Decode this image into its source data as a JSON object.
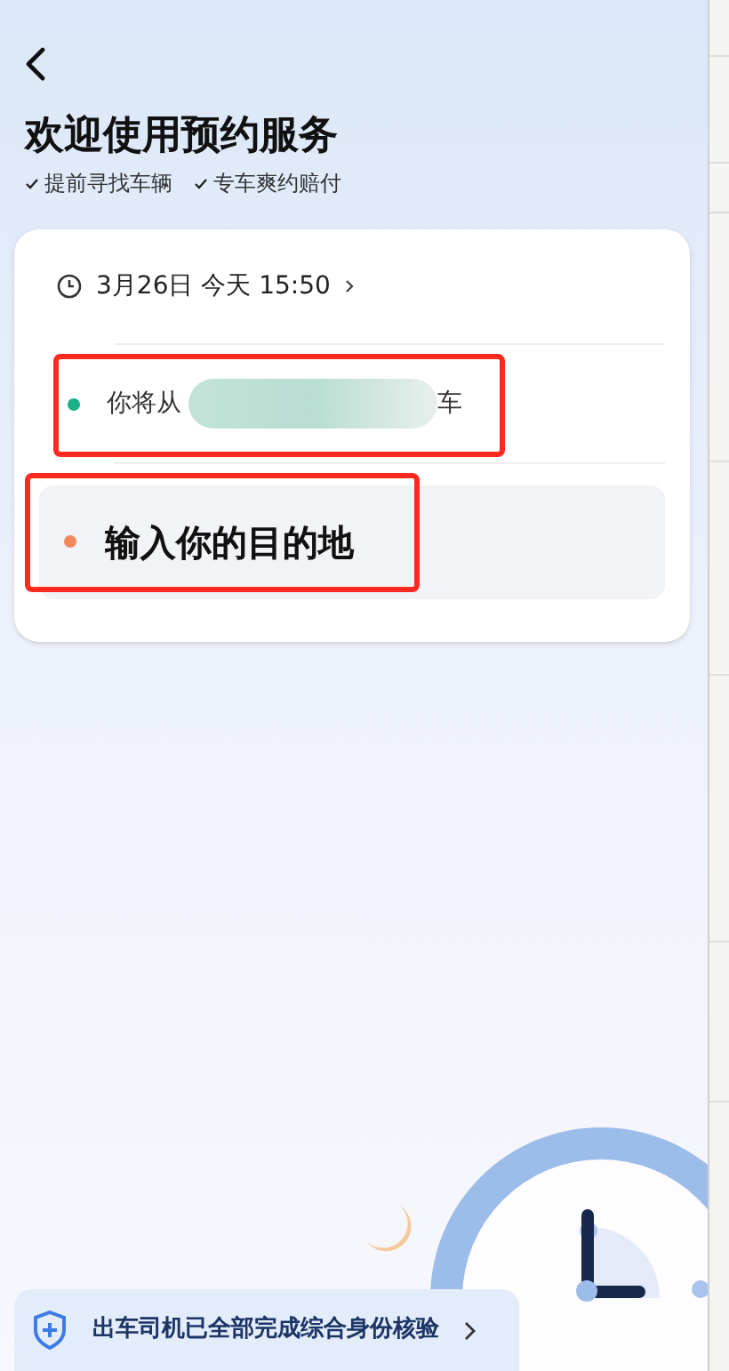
{
  "header": {
    "title": "欢迎使用预约服务",
    "benefits": [
      "提前寻找车辆",
      "专车爽约赔付"
    ]
  },
  "booking": {
    "time": "3月26日 今天 15:50",
    "route": [
      {
        "kind": "pickup",
        "color": "#1bb08c",
        "prefix": "你将从",
        "suffix": "车"
      },
      {
        "kind": "destination",
        "color": "#f3875c",
        "placeholder": "输入你的目的地"
      }
    ]
  },
  "banner": {
    "text": "出车司机已全部完成综合身份核验"
  }
}
